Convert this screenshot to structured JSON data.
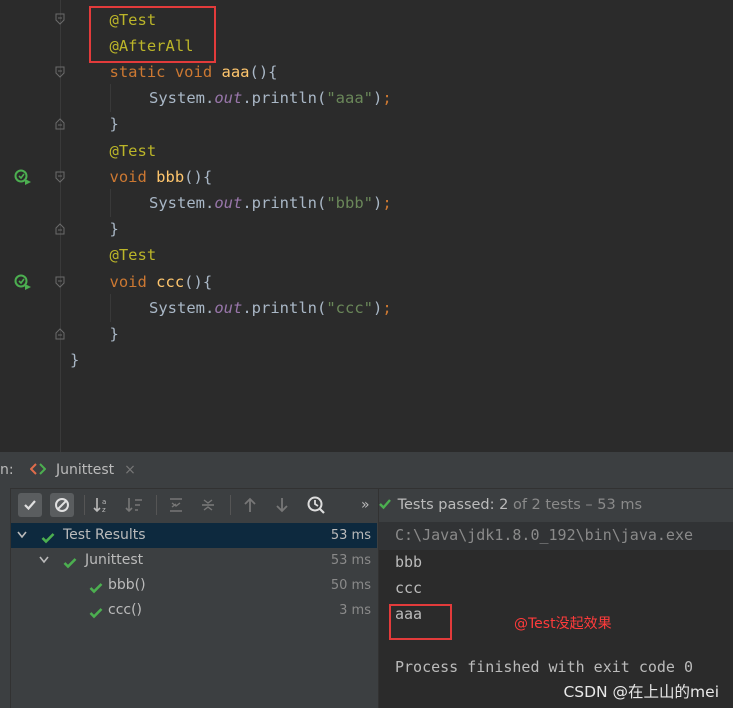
{
  "editor": {
    "lines": [
      {
        "tokens": [
          {
            "t": "ann",
            "v": "@Test"
          }
        ],
        "indent": 1
      },
      {
        "tokens": [
          {
            "t": "ann",
            "v": "@AfterAll"
          }
        ],
        "indent": 1
      },
      {
        "tokens": [
          {
            "t": "kw",
            "v": "static void "
          },
          {
            "t": "fn",
            "v": "aaa"
          },
          {
            "t": "plain",
            "v": "(){"
          }
        ],
        "indent": 1
      },
      {
        "tokens": [
          {
            "t": "plain",
            "v": "System."
          },
          {
            "t": "field",
            "v": "out"
          },
          {
            "t": "plain",
            "v": ".println("
          },
          {
            "t": "str",
            "v": "\"aaa\""
          },
          {
            "t": "plain",
            "v": ")"
          },
          {
            "t": "kw",
            "v": ";"
          }
        ],
        "indent": 2
      },
      {
        "tokens": [
          {
            "t": "plain",
            "v": "}"
          }
        ],
        "indent": 1
      },
      {
        "tokens": [
          {
            "t": "ann",
            "v": "@Test"
          }
        ],
        "indent": 1
      },
      {
        "tokens": [
          {
            "t": "kw",
            "v": "void "
          },
          {
            "t": "fn",
            "v": "bbb"
          },
          {
            "t": "plain",
            "v": "(){"
          }
        ],
        "indent": 1
      },
      {
        "tokens": [
          {
            "t": "plain",
            "v": "System."
          },
          {
            "t": "field",
            "v": "out"
          },
          {
            "t": "plain",
            "v": ".println("
          },
          {
            "t": "str",
            "v": "\"bbb\""
          },
          {
            "t": "plain",
            "v": ")"
          },
          {
            "t": "kw",
            "v": ";"
          }
        ],
        "indent": 2
      },
      {
        "tokens": [
          {
            "t": "plain",
            "v": "}"
          }
        ],
        "indent": 1
      },
      {
        "tokens": [
          {
            "t": "ann",
            "v": "@Test"
          }
        ],
        "indent": 1
      },
      {
        "tokens": [
          {
            "t": "kw",
            "v": "void "
          },
          {
            "t": "fn",
            "v": "ccc"
          },
          {
            "t": "plain",
            "v": "(){"
          }
        ],
        "indent": 1
      },
      {
        "tokens": [
          {
            "t": "plain",
            "v": "System."
          },
          {
            "t": "field",
            "v": "out"
          },
          {
            "t": "plain",
            "v": ".println("
          },
          {
            "t": "str",
            "v": "\"ccc\""
          },
          {
            "t": "plain",
            "v": ")"
          },
          {
            "t": "kw",
            "v": ";"
          }
        ],
        "indent": 2
      },
      {
        "tokens": [
          {
            "t": "plain",
            "v": "}"
          }
        ],
        "indent": 1
      },
      {
        "tokens": [
          {
            "t": "plain",
            "v": "}"
          }
        ],
        "indent": 0
      }
    ],
    "run_gutter_icons": [
      "run-test-icon",
      "run-test-icon"
    ]
  },
  "run_window": {
    "label": "n:",
    "tab_icon": "junit-icon",
    "tab_title": "Junittest",
    "tab_close": "×",
    "toolbar": [
      "show-passed-icon",
      "show-ignored-icon",
      "sort-alpha-icon",
      "sort-duration-icon",
      "expand-all-icon",
      "collapse-all-icon",
      "prev-failed-icon",
      "next-failed-icon",
      "history-icon"
    ],
    "more": "»",
    "status": {
      "prefix": "Tests passed: ",
      "passed": "2",
      "suffix": " of 2 tests – 53 ms"
    },
    "tree": [
      {
        "label": "Test Results",
        "time": "53 ms",
        "level": 0,
        "expanded": true
      },
      {
        "label": "Junittest",
        "time": "53 ms",
        "level": 1,
        "expanded": true
      },
      {
        "label": "bbb()",
        "time": "50 ms",
        "level": 2
      },
      {
        "label": "ccc()",
        "time": "3 ms",
        "level": 2
      }
    ],
    "console": {
      "command": "C:\\Java\\jdk1.8.0_192\\bin\\java.exe",
      "output": [
        "bbb",
        "ccc",
        "aaa"
      ],
      "blank": "",
      "finish": "Process finished with exit code 0"
    },
    "annotation": "@Test没起效果",
    "watermark": "CSDN @在上山的mei"
  },
  "colors": {
    "annotation": "#bbb529",
    "keyword": "#cc7832",
    "function": "#ffc66d",
    "string": "#6a8759",
    "field": "#9876aa",
    "pass": "#4caf50",
    "highlight": "#e23b3b"
  }
}
